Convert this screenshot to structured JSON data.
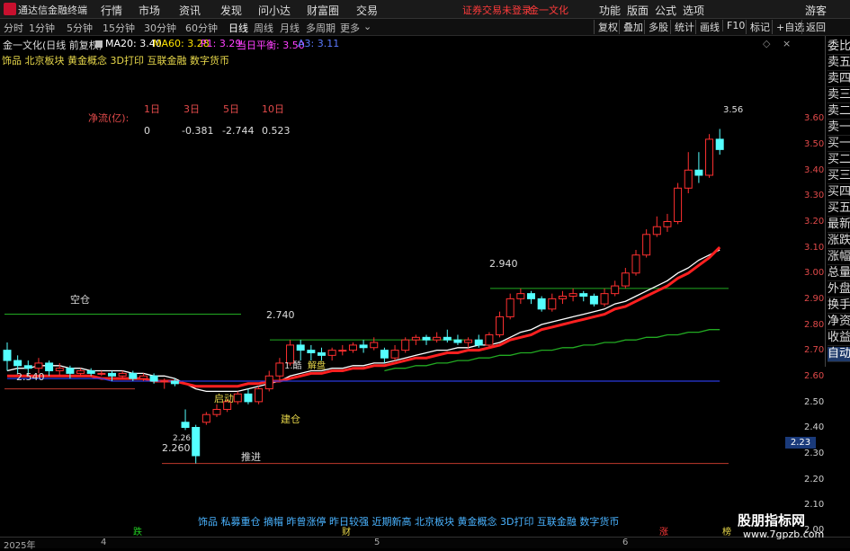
{
  "app": {
    "name": "通达信金融终端"
  },
  "menu": [
    "行情",
    "市场",
    "资讯",
    "发现",
    "问小达",
    "财富圈",
    "交易"
  ],
  "header_status": "证券交易未登录",
  "header_stock": "金一文化",
  "right_menu": [
    "功能",
    "版面",
    "公式",
    "选项",
    "游客"
  ],
  "periods": [
    "分时",
    "1分钟",
    "5分钟",
    "15分钟",
    "30分钟",
    "60分钟",
    "日线",
    "周线",
    "月线",
    "多周期",
    "更多"
  ],
  "active_period": "日线",
  "toolbar_right": [
    "复权",
    "叠加",
    "多股",
    "统计",
    "画线",
    "F10",
    "标记",
    "+自选",
    "返回"
  ],
  "info": {
    "title": "金一文化(日线 前复权)",
    "ma20": "MA20: 3.40",
    "ma60": "MA60: 3.28",
    "p1": "P1: 3.29",
    "avg": "当日平衡: 3.50",
    "a3": "A3: 3.11"
  },
  "concepts_top": "饰品 北京板块 黄金概念 3D打印 互联金融 数字货币",
  "concepts_bottom": "饰品 私募重仓 摘帽 昨曾涨停 昨日较强 近期新高 北京板块 黄金概念 3D打印 互联金融 数字货币",
  "netflow": {
    "label": "净流(亿):",
    "headers": [
      "1日",
      "3日",
      "5日",
      "10日"
    ],
    "values": [
      "0",
      "-0.381",
      "-2.744",
      "0.523"
    ]
  },
  "sidebar": [
    "委比",
    "卖五",
    "卖四",
    "卖三",
    "卖二",
    "卖一",
    "买一",
    "买二",
    "买三",
    "买四",
    "买五",
    "最新",
    "涨跌",
    "涨幅",
    "总量",
    "外盘",
    "换手",
    "净资",
    "收益",
    "自动"
  ],
  "sidebar_active": "自动",
  "y_axis": [
    "3.60",
    "3.50",
    "3.40",
    "3.30",
    "3.20",
    "3.10",
    "3.00",
    "2.90",
    "2.80",
    "2.70",
    "2.60",
    "2.50",
    "2.40",
    "2.30",
    "2.20",
    "2.10",
    "2.00"
  ],
  "current_price": "2.23",
  "annotations": {
    "empty_position": "空仓",
    "start": "启动",
    "build": "建仓",
    "advance": "推进",
    "low_price": "2.260",
    "low_mark": "2.26",
    "left_price": "2.540",
    "mid_price": "2.740",
    "peak_price": "2.940",
    "top_price": "3.56",
    "top_mark": "3.56",
    "trap_left": "1.酷",
    "trap_right": "解盘"
  },
  "timeline": [
    "2025年",
    "4",
    "5",
    "6"
  ],
  "bottom_marks": {
    "down": "跌",
    "cai": "财",
    "up": "涨",
    "gao": "榜"
  },
  "watermark": "股朋指标网",
  "watermark_url": "www.7gpzb.com",
  "chart_data": {
    "type": "candlestick",
    "ylim": [
      2.0,
      3.65
    ],
    "candles": [
      {
        "o": 2.7,
        "c": 2.66,
        "h": 2.73,
        "l": 2.62
      },
      {
        "o": 2.66,
        "c": 2.64,
        "h": 2.68,
        "l": 2.61
      },
      {
        "o": 2.64,
        "c": 2.63,
        "h": 2.66,
        "l": 2.6
      },
      {
        "o": 2.63,
        "c": 2.65,
        "h": 2.67,
        "l": 2.61
      },
      {
        "o": 2.65,
        "c": 2.62,
        "h": 2.66,
        "l": 2.6
      },
      {
        "o": 2.62,
        "c": 2.63,
        "h": 2.65,
        "l": 2.6
      },
      {
        "o": 2.63,
        "c": 2.61,
        "h": 2.64,
        "l": 2.59
      },
      {
        "o": 2.61,
        "c": 2.62,
        "h": 2.63,
        "l": 2.6
      },
      {
        "o": 2.62,
        "c": 2.61,
        "h": 2.63,
        "l": 2.6
      },
      {
        "o": 2.61,
        "c": 2.61,
        "h": 2.62,
        "l": 2.6
      },
      {
        "o": 2.61,
        "c": 2.6,
        "h": 2.62,
        "l": 2.58
      },
      {
        "o": 2.6,
        "c": 2.61,
        "h": 2.62,
        "l": 2.59
      },
      {
        "o": 2.61,
        "c": 2.59,
        "h": 2.62,
        "l": 2.58
      },
      {
        "o": 2.59,
        "c": 2.6,
        "h": 2.61,
        "l": 2.58
      },
      {
        "o": 2.6,
        "c": 2.58,
        "h": 2.61,
        "l": 2.57
      },
      {
        "o": 2.58,
        "c": 2.58,
        "h": 2.59,
        "l": 2.55
      },
      {
        "o": 2.58,
        "c": 2.57,
        "h": 2.59,
        "l": 2.56
      },
      {
        "o": 2.42,
        "c": 2.4,
        "h": 2.47,
        "l": 2.39
      },
      {
        "o": 2.4,
        "c": 2.29,
        "h": 2.41,
        "l": 2.26
      },
      {
        "o": 2.42,
        "c": 2.45,
        "h": 2.46,
        "l": 2.41
      },
      {
        "o": 2.45,
        "c": 2.47,
        "h": 2.49,
        "l": 2.44
      },
      {
        "o": 2.47,
        "c": 2.5,
        "h": 2.51,
        "l": 2.46
      },
      {
        "o": 2.5,
        "c": 2.53,
        "h": 2.54,
        "l": 2.49
      },
      {
        "o": 2.53,
        "c": 2.5,
        "h": 2.55,
        "l": 2.49
      },
      {
        "o": 2.5,
        "c": 2.55,
        "h": 2.56,
        "l": 2.49
      },
      {
        "o": 2.55,
        "c": 2.6,
        "h": 2.62,
        "l": 2.54
      },
      {
        "o": 2.6,
        "c": 2.65,
        "h": 2.67,
        "l": 2.58
      },
      {
        "o": 2.65,
        "c": 2.72,
        "h": 2.74,
        "l": 2.64
      },
      {
        "o": 2.72,
        "c": 2.7,
        "h": 2.74,
        "l": 2.66
      },
      {
        "o": 2.7,
        "c": 2.69,
        "h": 2.72,
        "l": 2.66
      },
      {
        "o": 2.69,
        "c": 2.68,
        "h": 2.71,
        "l": 2.66
      },
      {
        "o": 2.68,
        "c": 2.7,
        "h": 2.71,
        "l": 2.66
      },
      {
        "o": 2.7,
        "c": 2.7,
        "h": 2.72,
        "l": 2.68
      },
      {
        "o": 2.7,
        "c": 2.72,
        "h": 2.73,
        "l": 2.69
      },
      {
        "o": 2.72,
        "c": 2.71,
        "h": 2.74,
        "l": 2.69
      },
      {
        "o": 2.71,
        "c": 2.73,
        "h": 2.75,
        "l": 2.7
      },
      {
        "o": 2.7,
        "c": 2.67,
        "h": 2.71,
        "l": 2.65
      },
      {
        "o": 2.67,
        "c": 2.7,
        "h": 2.72,
        "l": 2.66
      },
      {
        "o": 2.7,
        "c": 2.74,
        "h": 2.75,
        "l": 2.69
      },
      {
        "o": 2.74,
        "c": 2.75,
        "h": 2.76,
        "l": 2.72
      },
      {
        "o": 2.75,
        "c": 2.74,
        "h": 2.76,
        "l": 2.72
      },
      {
        "o": 2.74,
        "c": 2.75,
        "h": 2.77,
        "l": 2.73
      },
      {
        "o": 2.75,
        "c": 2.74,
        "h": 2.78,
        "l": 2.73
      },
      {
        "o": 2.74,
        "c": 2.73,
        "h": 2.76,
        "l": 2.72
      },
      {
        "o": 2.73,
        "c": 2.74,
        "h": 2.75,
        "l": 2.71
      },
      {
        "o": 2.74,
        "c": 2.72,
        "h": 2.76,
        "l": 2.71
      },
      {
        "o": 2.72,
        "c": 2.76,
        "h": 2.77,
        "l": 2.71
      },
      {
        "o": 2.76,
        "c": 2.83,
        "h": 2.85,
        "l": 2.75
      },
      {
        "o": 2.83,
        "c": 2.9,
        "h": 2.92,
        "l": 2.82
      },
      {
        "o": 2.9,
        "c": 2.92,
        "h": 2.94,
        "l": 2.88
      },
      {
        "o": 2.92,
        "c": 2.9,
        "h": 2.93,
        "l": 2.88
      },
      {
        "o": 2.9,
        "c": 2.86,
        "h": 2.91,
        "l": 2.85
      },
      {
        "o": 2.86,
        "c": 2.9,
        "h": 2.92,
        "l": 2.85
      },
      {
        "o": 2.9,
        "c": 2.91,
        "h": 2.93,
        "l": 2.88
      },
      {
        "o": 2.91,
        "c": 2.92,
        "h": 2.94,
        "l": 2.89
      },
      {
        "o": 2.92,
        "c": 2.91,
        "h": 2.93,
        "l": 2.89
      },
      {
        "o": 2.91,
        "c": 2.88,
        "h": 2.92,
        "l": 2.87
      },
      {
        "o": 2.88,
        "c": 2.92,
        "h": 2.94,
        "l": 2.87
      },
      {
        "o": 2.92,
        "c": 2.95,
        "h": 2.97,
        "l": 2.91
      },
      {
        "o": 2.95,
        "c": 3.0,
        "h": 3.02,
        "l": 2.94
      },
      {
        "o": 3.0,
        "c": 3.07,
        "h": 3.09,
        "l": 2.99
      },
      {
        "o": 3.07,
        "c": 3.15,
        "h": 3.17,
        "l": 3.06
      },
      {
        "o": 3.15,
        "c": 3.18,
        "h": 3.22,
        "l": 3.14
      },
      {
        "o": 3.18,
        "c": 3.2,
        "h": 3.23,
        "l": 3.16
      },
      {
        "o": 3.2,
        "c": 3.33,
        "h": 3.35,
        "l": 3.19
      },
      {
        "o": 3.33,
        "c": 3.4,
        "h": 3.47,
        "l": 3.31
      },
      {
        "o": 3.4,
        "c": 3.38,
        "h": 3.47,
        "l": 3.35
      },
      {
        "o": 3.38,
        "c": 3.52,
        "h": 3.54,
        "l": 3.37
      },
      {
        "o": 3.52,
        "c": 3.48,
        "h": 3.56,
        "l": 3.46
      }
    ],
    "ma": [
      {
        "name": "MA20",
        "color": "#ffffff",
        "values": [
          2.62,
          2.63,
          2.63,
          2.64,
          2.64,
          2.64,
          2.63,
          2.63,
          2.62,
          2.62,
          2.62,
          2.62,
          2.61,
          2.61,
          2.6,
          2.6,
          2.59,
          2.57,
          2.55,
          2.54,
          2.54,
          2.54,
          2.54,
          2.55,
          2.56,
          2.57,
          2.58,
          2.6,
          2.61,
          2.62,
          2.62,
          2.63,
          2.63,
          2.64,
          2.64,
          2.65,
          2.65,
          2.66,
          2.67,
          2.68,
          2.69,
          2.7,
          2.7,
          2.71,
          2.71,
          2.72,
          2.72,
          2.73,
          2.75,
          2.77,
          2.78,
          2.8,
          2.81,
          2.82,
          2.83,
          2.84,
          2.85,
          2.86,
          2.88,
          2.89,
          2.91,
          2.93,
          2.95,
          2.97,
          3.0,
          3.02,
          3.05,
          3.07,
          3.09
        ]
      },
      {
        "name": "MA60",
        "color": "#ff2020",
        "values": [
          2.6,
          2.6,
          2.6,
          2.6,
          2.6,
          2.6,
          2.6,
          2.6,
          2.6,
          2.59,
          2.59,
          2.59,
          2.59,
          2.59,
          2.58,
          2.58,
          2.58,
          2.57,
          2.56,
          2.56,
          2.56,
          2.56,
          2.56,
          2.57,
          2.57,
          2.58,
          2.58,
          2.59,
          2.6,
          2.61,
          2.61,
          2.62,
          2.62,
          2.63,
          2.63,
          2.64,
          2.64,
          2.65,
          2.66,
          2.67,
          2.67,
          2.68,
          2.69,
          2.69,
          2.7,
          2.7,
          2.71,
          2.72,
          2.74,
          2.75,
          2.76,
          2.78,
          2.79,
          2.8,
          2.81,
          2.82,
          2.83,
          2.84,
          2.86,
          2.87,
          2.89,
          2.91,
          2.93,
          2.95,
          2.98,
          3.0,
          3.03,
          3.06,
          3.1
        ]
      },
      {
        "name": "MA120",
        "color": "#22aa22",
        "values": [
          null,
          null,
          null,
          null,
          null,
          null,
          null,
          null,
          null,
          null,
          null,
          null,
          null,
          null,
          null,
          null,
          null,
          null,
          null,
          null,
          null,
          null,
          null,
          null,
          null,
          null,
          null,
          null,
          null,
          null,
          null,
          null,
          null,
          null,
          null,
          null,
          2.62,
          2.63,
          2.63,
          2.64,
          2.64,
          2.65,
          2.65,
          2.66,
          2.66,
          2.67,
          2.67,
          2.68,
          2.68,
          2.69,
          2.69,
          2.7,
          2.7,
          2.71,
          2.71,
          2.72,
          2.72,
          2.73,
          2.73,
          2.74,
          2.74,
          2.75,
          2.75,
          2.76,
          2.76,
          2.77,
          2.77,
          2.78,
          2.78
        ]
      },
      {
        "name": "MA250",
        "color": "#2a3adc",
        "values": [
          2.59,
          2.59,
          2.59,
          2.59,
          2.59,
          2.59,
          2.59,
          2.59,
          2.59,
          2.59,
          2.58,
          2.58,
          2.58,
          2.58,
          2.58,
          2.58,
          2.58,
          2.58,
          2.58,
          2.58,
          2.58,
          2.58,
          2.58,
          2.58,
          2.58,
          2.58,
          2.58,
          2.58,
          2.58,
          2.58,
          2.58,
          2.58,
          2.58,
          2.58,
          2.58,
          2.58,
          2.58,
          2.58,
          2.58,
          2.58,
          2.58,
          2.58,
          2.58,
          2.58,
          2.58,
          2.58,
          2.58,
          2.58,
          2.58,
          2.58,
          2.58,
          2.58,
          2.58,
          2.58,
          2.58,
          2.58,
          2.58,
          2.58,
          2.58,
          2.58,
          2.58,
          2.58,
          2.58,
          2.58,
          2.58,
          2.58,
          2.58,
          2.58,
          2.58
        ]
      }
    ]
  }
}
